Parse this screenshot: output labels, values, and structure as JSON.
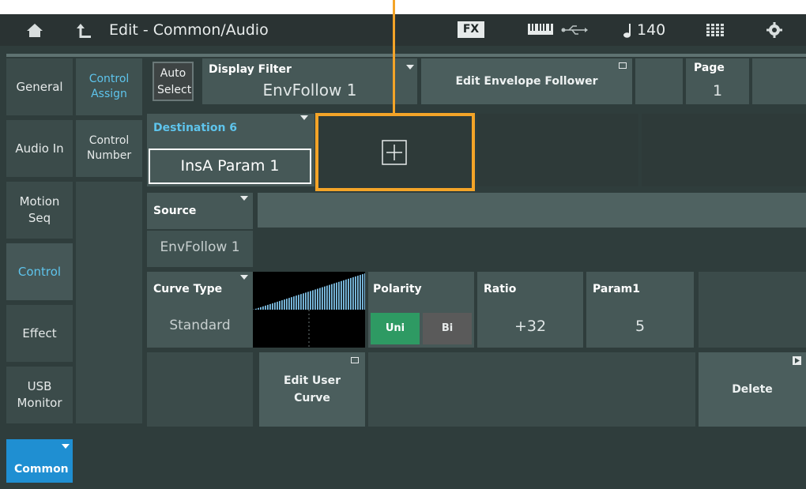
{
  "header": {
    "title": "Edit - Common/Audio",
    "fx_label": "FX",
    "tempo": "140"
  },
  "sidebar": {
    "items": [
      {
        "label": "General"
      },
      {
        "label": "Audio In"
      },
      {
        "label": "Motion Seq"
      },
      {
        "label": "Control"
      },
      {
        "label": "Effect"
      },
      {
        "label": "USB Monitor"
      }
    ]
  },
  "subtabs": {
    "control_assign": "Control Assign",
    "control_number": "Control Number"
  },
  "toolbar": {
    "auto_select": "Auto Select",
    "display_filter_label": "Display Filter",
    "display_filter_value": "EnvFollow 1",
    "edit_env_follower": "Edit Envelope Follower",
    "page_label": "Page",
    "page_value": "1"
  },
  "destination": {
    "label": "Destination 6",
    "value": "InsA Param 1"
  },
  "source": {
    "label": "Source",
    "value": "EnvFollow 1"
  },
  "curve": {
    "label": "Curve Type",
    "value": "Standard"
  },
  "polarity": {
    "label": "Polarity",
    "uni": "Uni",
    "bi": "Bi",
    "selected": "Uni"
  },
  "ratio": {
    "label": "Ratio",
    "value": "+32"
  },
  "param1": {
    "label": "Param1",
    "value": "5"
  },
  "buttons": {
    "edit_user_curve": "Edit User Curve",
    "delete": "Delete"
  },
  "bottom": {
    "common": "Common"
  },
  "colors": {
    "accent_blue": "#5ec4ec",
    "highlight_orange": "#f4a428",
    "uni_green": "#2e9a63"
  }
}
